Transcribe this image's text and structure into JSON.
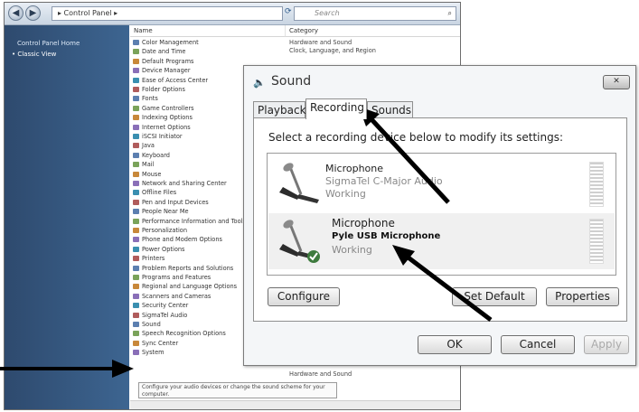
{
  "control_panel": {
    "breadcrumb": "▸ Control Panel ▸",
    "search_placeholder": "Search",
    "sidebar": {
      "home": "Control Panel Home",
      "classic_view": "• Classic View"
    },
    "columns": {
      "name": "Name",
      "category": "Category"
    },
    "items": [
      "Color Management",
      "Date and Time",
      "Default Programs",
      "Device Manager",
      "Ease of Access Center",
      "Folder Options",
      "Fonts",
      "Game Controllers",
      "Indexing Options",
      "Internet Options",
      "iSCSI Initiator",
      "Java",
      "Keyboard",
      "Mail",
      "Mouse",
      "Network and Sharing Center",
      "Offline Files",
      "Pen and Input Devices",
      "People Near Me",
      "Performance Information and Tools",
      "Personalization",
      "Phone and Modem Options",
      "Power Options",
      "Printers",
      "Problem Reports and Solutions",
      "Programs and Features",
      "Regional and Language Options",
      "Scanners and Cameras",
      "Security Center",
      "SigmaTel Audio",
      "Sound",
      "Speech Recognition Options",
      "Sync Center",
      "System"
    ],
    "categories": [
      "Hardware and Sound",
      "Clock, Language, and Region"
    ],
    "sound_category": "Hardware and Sound",
    "tooltip": "Configure your audio devices or change the sound scheme for your computer."
  },
  "dialog": {
    "title": "Sound",
    "close_label": "✕",
    "tabs": [
      "Playback",
      "Recording",
      "Sounds"
    ],
    "prompt": "Select a recording device below to modify its settings:",
    "devices": [
      {
        "name": "Microphone",
        "description": "SigmaTel C-Major Audio",
        "status": "Working"
      },
      {
        "name": "Microphone",
        "description": "Pyle USB Microphone",
        "status": "Working"
      }
    ],
    "buttons": {
      "configure": "Configure",
      "set_default": "Set Default",
      "properties": "Properties",
      "ok": "OK",
      "cancel": "Cancel",
      "apply": "Apply"
    }
  },
  "icon_colors": [
    "#5c7fb0",
    "#7aa35a",
    "#c8883a",
    "#8a6fb8",
    "#3a8fb0",
    "#b05c5c"
  ]
}
